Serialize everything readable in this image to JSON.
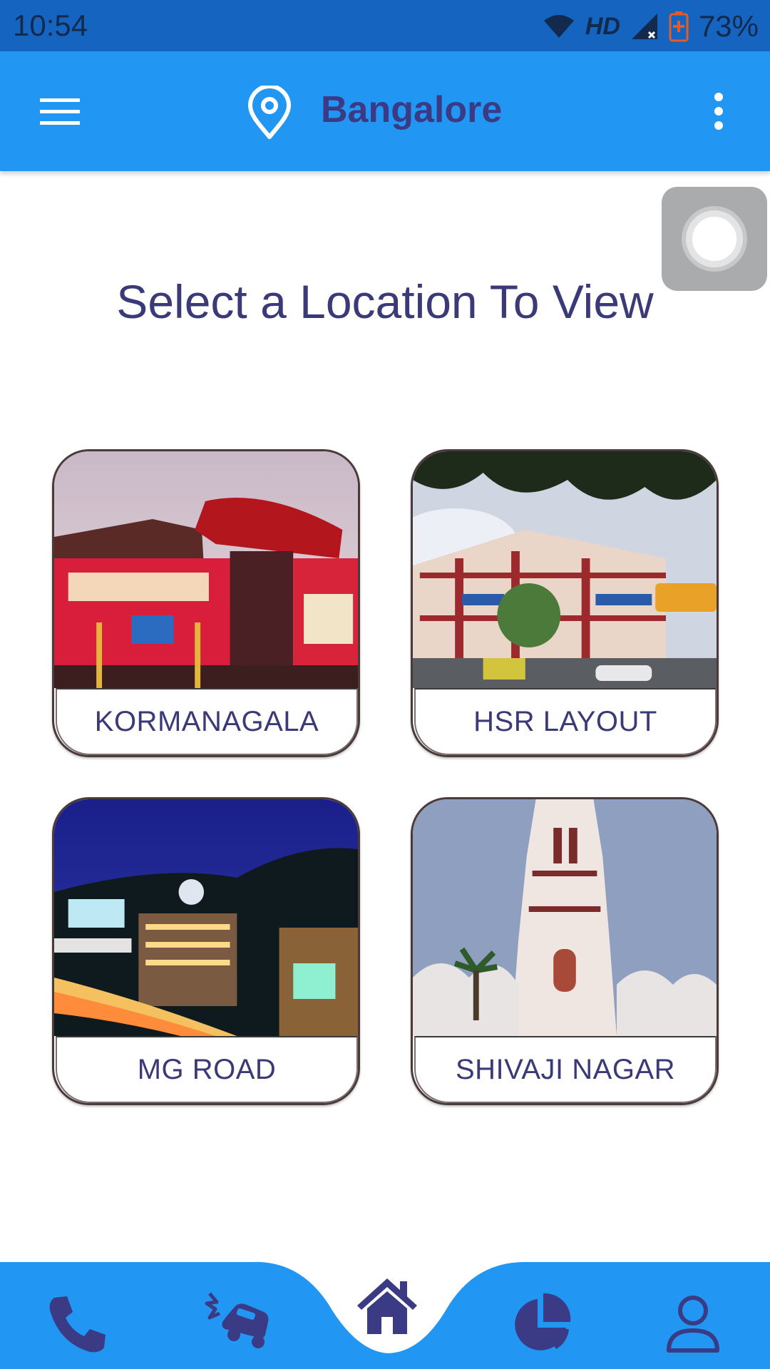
{
  "status_bar": {
    "time": "10:54",
    "network": "HD",
    "battery": "73%"
  },
  "app_bar": {
    "city": "Bangalore",
    "menu_icon": "hamburger-menu-icon",
    "location_icon": "map-pin-icon",
    "more_icon": "more-vertical-icon"
  },
  "main": {
    "title": "Select a Location To View",
    "locations": [
      {
        "label": "KORMANAGALA"
      },
      {
        "label": "HSR LAYOUT"
      },
      {
        "label": "MG ROAD"
      },
      {
        "label": "SHIVAJI NAGAR"
      }
    ]
  },
  "bottom_nav": {
    "items": [
      {
        "icon": "phone-icon"
      },
      {
        "icon": "car-crash-icon"
      },
      {
        "icon": "home-icon",
        "selected": true
      },
      {
        "icon": "pie-chart-icon"
      },
      {
        "icon": "user-icon"
      }
    ]
  },
  "colors": {
    "app_bar": "#2196f3",
    "status_bar": "#1565c0",
    "text_primary": "#3b3a78",
    "nav_icon": "#3b3a85"
  }
}
